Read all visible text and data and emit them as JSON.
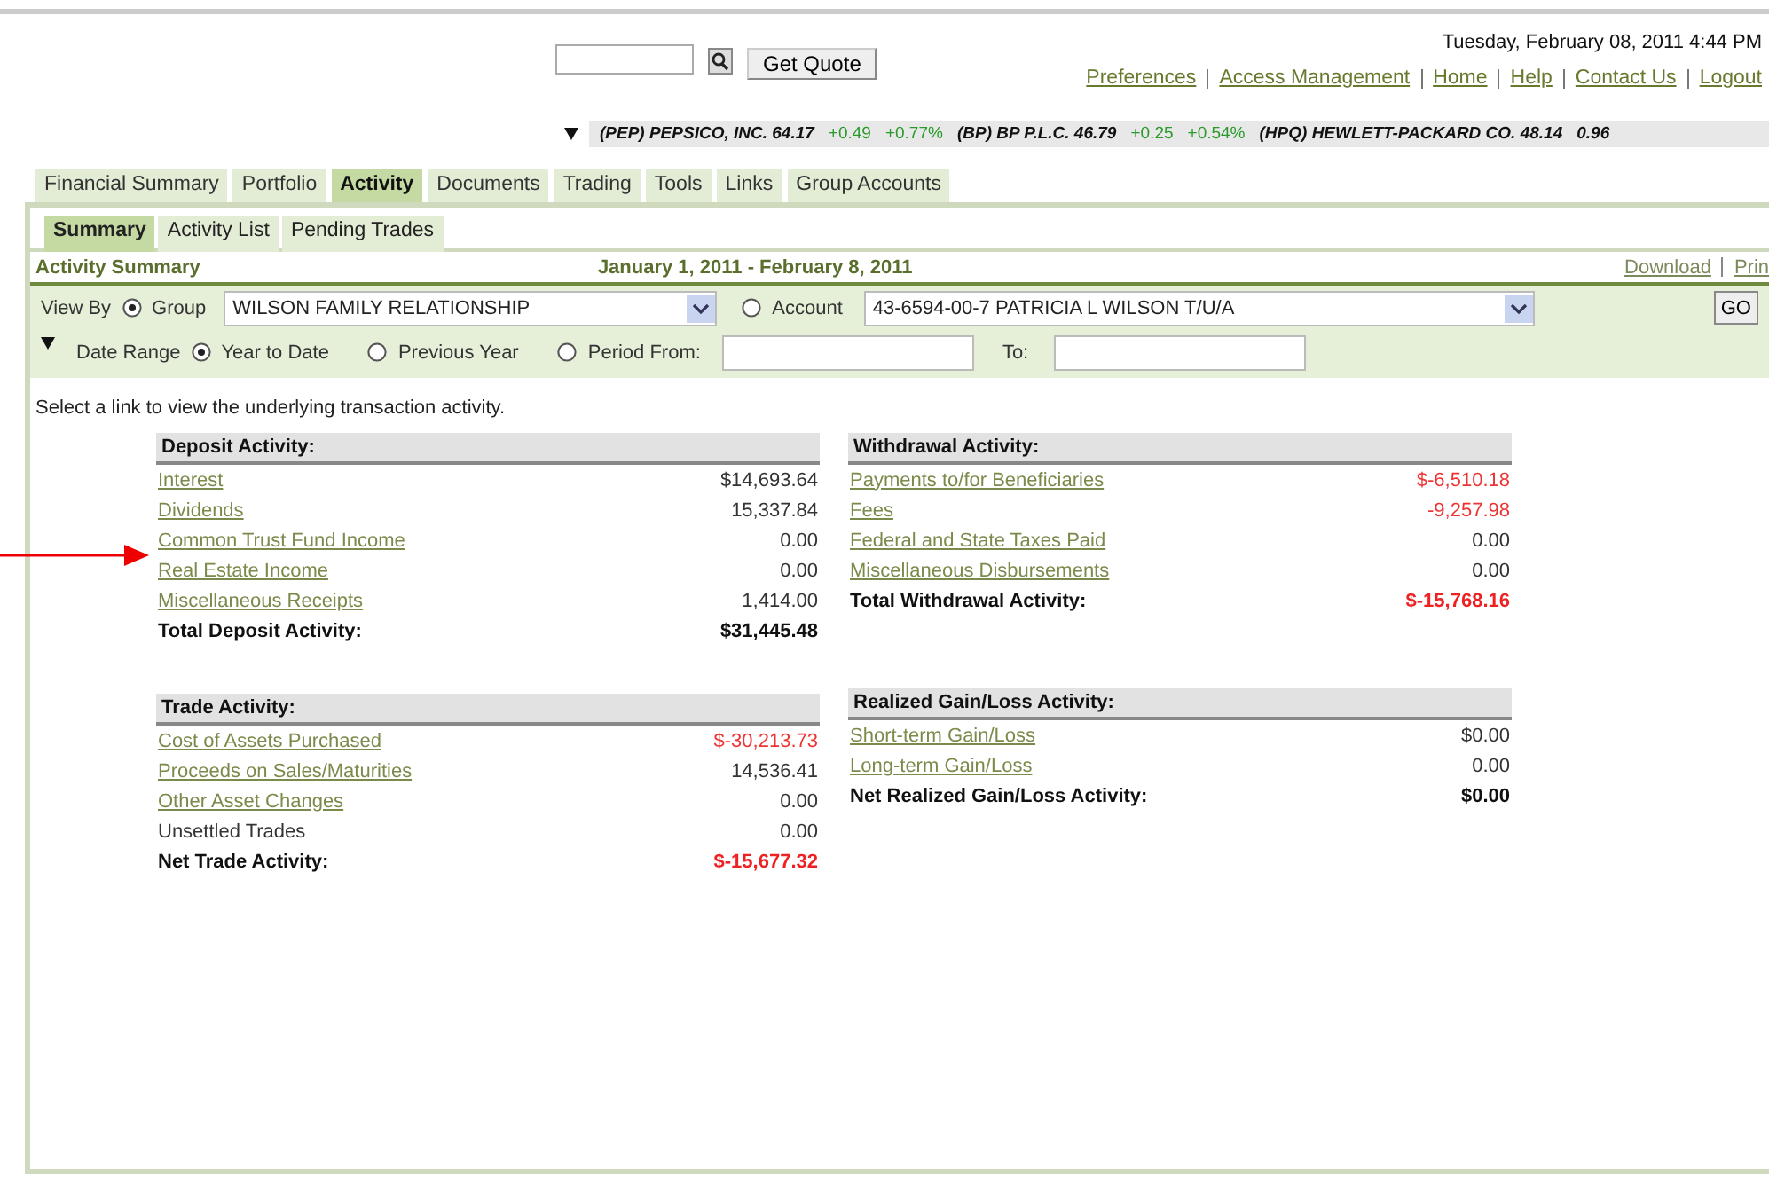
{
  "quote": {
    "button": "Get Quote"
  },
  "datetime": "Tuesday, February 08, 2011 4:44 PM",
  "links": [
    "Preferences",
    "Access Management",
    "Home",
    "Help",
    "Contact Us",
    "Logout"
  ],
  "ticker": [
    {
      "text": "(PEP) PEPSICO, INC. 64.17",
      "kind": "name"
    },
    {
      "text": "+0.49",
      "kind": "change"
    },
    {
      "text": "+0.77%",
      "kind": "change"
    },
    {
      "text": "(BP) BP P.L.C. 46.79",
      "kind": "name"
    },
    {
      "text": "+0.25",
      "kind": "change"
    },
    {
      "text": "+0.54%",
      "kind": "change"
    },
    {
      "text": "(HPQ) HEWLETT-PACKARD CO. 48.14",
      "kind": "name"
    },
    {
      "text": "0.96",
      "kind": "name"
    }
  ],
  "tabs": [
    {
      "label": "Financial Summary",
      "selected": false
    },
    {
      "label": "Portfolio",
      "selected": false
    },
    {
      "label": "Activity",
      "selected": true
    },
    {
      "label": "Documents",
      "selected": false
    },
    {
      "label": "Trading",
      "selected": false
    },
    {
      "label": "Tools",
      "selected": false
    },
    {
      "label": "Links",
      "selected": false
    },
    {
      "label": "Group Accounts",
      "selected": false
    }
  ],
  "subtabs": [
    {
      "label": "Summary",
      "selected": true
    },
    {
      "label": "Activity List",
      "selected": false
    },
    {
      "label": "Pending Trades",
      "selected": false
    }
  ],
  "summary": {
    "title": "Activity Summary",
    "range": "January 1, 2011 - February 8, 2011",
    "actions": [
      "Download",
      "Prin"
    ]
  },
  "view_by": {
    "label": "View By",
    "group": {
      "label": "Group",
      "selected": true,
      "value": "WILSON FAMILY RELATIONSHIP"
    },
    "account": {
      "label": "Account",
      "selected": false,
      "value": "43-6594-00-7 PATRICIA L WILSON T/U/A"
    },
    "go": "GO"
  },
  "date_range": {
    "label": "Date Range",
    "options": [
      {
        "label": "Year to Date",
        "selected": true
      },
      {
        "label": "Previous Year",
        "selected": false
      },
      {
        "label": "Period From:",
        "selected": false
      }
    ],
    "to": "To:"
  },
  "instruction": "Select a link to view the underlying transaction activity.",
  "columns": [
    [
      {
        "title": "Deposit Activity:",
        "rows": [
          {
            "label": "Interest",
            "value": "$14,693.64",
            "kind": "link",
            "negative": false
          },
          {
            "label": "Dividends",
            "value": "15,337.84",
            "kind": "link",
            "negative": false
          },
          {
            "label": "Common Trust Fund Income",
            "value": "0.00",
            "kind": "link",
            "negative": false
          },
          {
            "label": "Real Estate Income",
            "value": "0.00",
            "kind": "link",
            "negative": false
          },
          {
            "label": "Miscellaneous Receipts",
            "value": "1,414.00",
            "kind": "link",
            "negative": false
          },
          {
            "label": "Total Deposit Activity:",
            "value": "$31,445.48",
            "kind": "total",
            "negative": false
          }
        ]
      },
      {
        "title": "Trade Activity:",
        "rows": [
          {
            "label": "Cost of Assets Purchased",
            "value": "$-30,213.73",
            "kind": "link",
            "negative": true
          },
          {
            "label": "Proceeds on Sales/Maturities",
            "value": "14,536.41",
            "kind": "link",
            "negative": false
          },
          {
            "label": "Other Asset Changes",
            "value": "0.00",
            "kind": "link",
            "negative": false
          },
          {
            "label": "Unsettled Trades",
            "value": "0.00",
            "kind": "plain",
            "negative": false
          },
          {
            "label": "Net Trade Activity:",
            "value": "$-15,677.32",
            "kind": "total",
            "negative": true
          }
        ]
      }
    ],
    [
      {
        "title": "Withdrawal Activity:",
        "rows": [
          {
            "label": "Payments to/for Beneficiaries",
            "value": "$-6,510.18",
            "kind": "link",
            "negative": true
          },
          {
            "label": "Fees",
            "value": "-9,257.98",
            "kind": "link",
            "negative": true
          },
          {
            "label": "Federal and State Taxes Paid",
            "value": "0.00",
            "kind": "link",
            "negative": false
          },
          {
            "label": "Miscellaneous Disbursements",
            "value": "0.00",
            "kind": "link",
            "negative": false
          },
          {
            "label": "Total Withdrawal Activity:",
            "value": "$-15,768.16",
            "kind": "total",
            "negative": true
          }
        ]
      },
      {
        "title": "Realized Gain/Loss Activity:",
        "rows": [
          {
            "label": "Short-term Gain/Loss",
            "value": "$0.00",
            "kind": "link",
            "negative": false
          },
          {
            "label": "Long-term Gain/Loss",
            "value": "0.00",
            "kind": "link",
            "negative": false
          },
          {
            "label": "Net Realized Gain/Loss Activity:",
            "value": "$0.00",
            "kind": "total",
            "negative": false
          }
        ]
      }
    ]
  ]
}
